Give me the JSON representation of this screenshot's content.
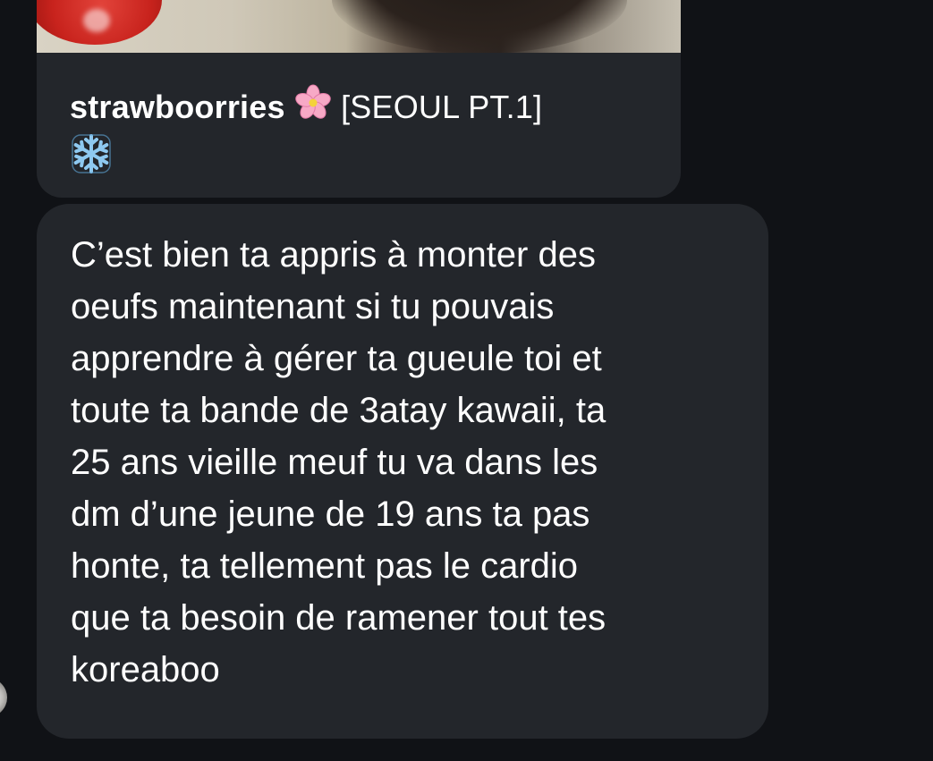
{
  "shared_post": {
    "author": "strawboorries",
    "author_emoji": "🌸",
    "caption": "[SEOUL PT.1]",
    "caption_emoji": "❄️"
  },
  "message": {
    "text": "C’est bien ta appris à monter des\noeufs maintenant si tu pouvais\napprendre à gérer ta gueule toi et\ntoute ta bande de 3atay kawaii, ta\n25 ans vieille meuf tu va dans les\ndm d’une jeune de 19 ans ta pas\nhonte, ta tellement pas le cardio\nque ta besoin de ramener tout tes\nkoreaboo"
  },
  "icons": {
    "flower": "cherry-blossom-icon",
    "snowflake": "snowflake-icon",
    "avatar": "sender-avatar"
  },
  "colors": {
    "background": "#101216",
    "bubble": "#23262b",
    "text": "#ffffff"
  }
}
